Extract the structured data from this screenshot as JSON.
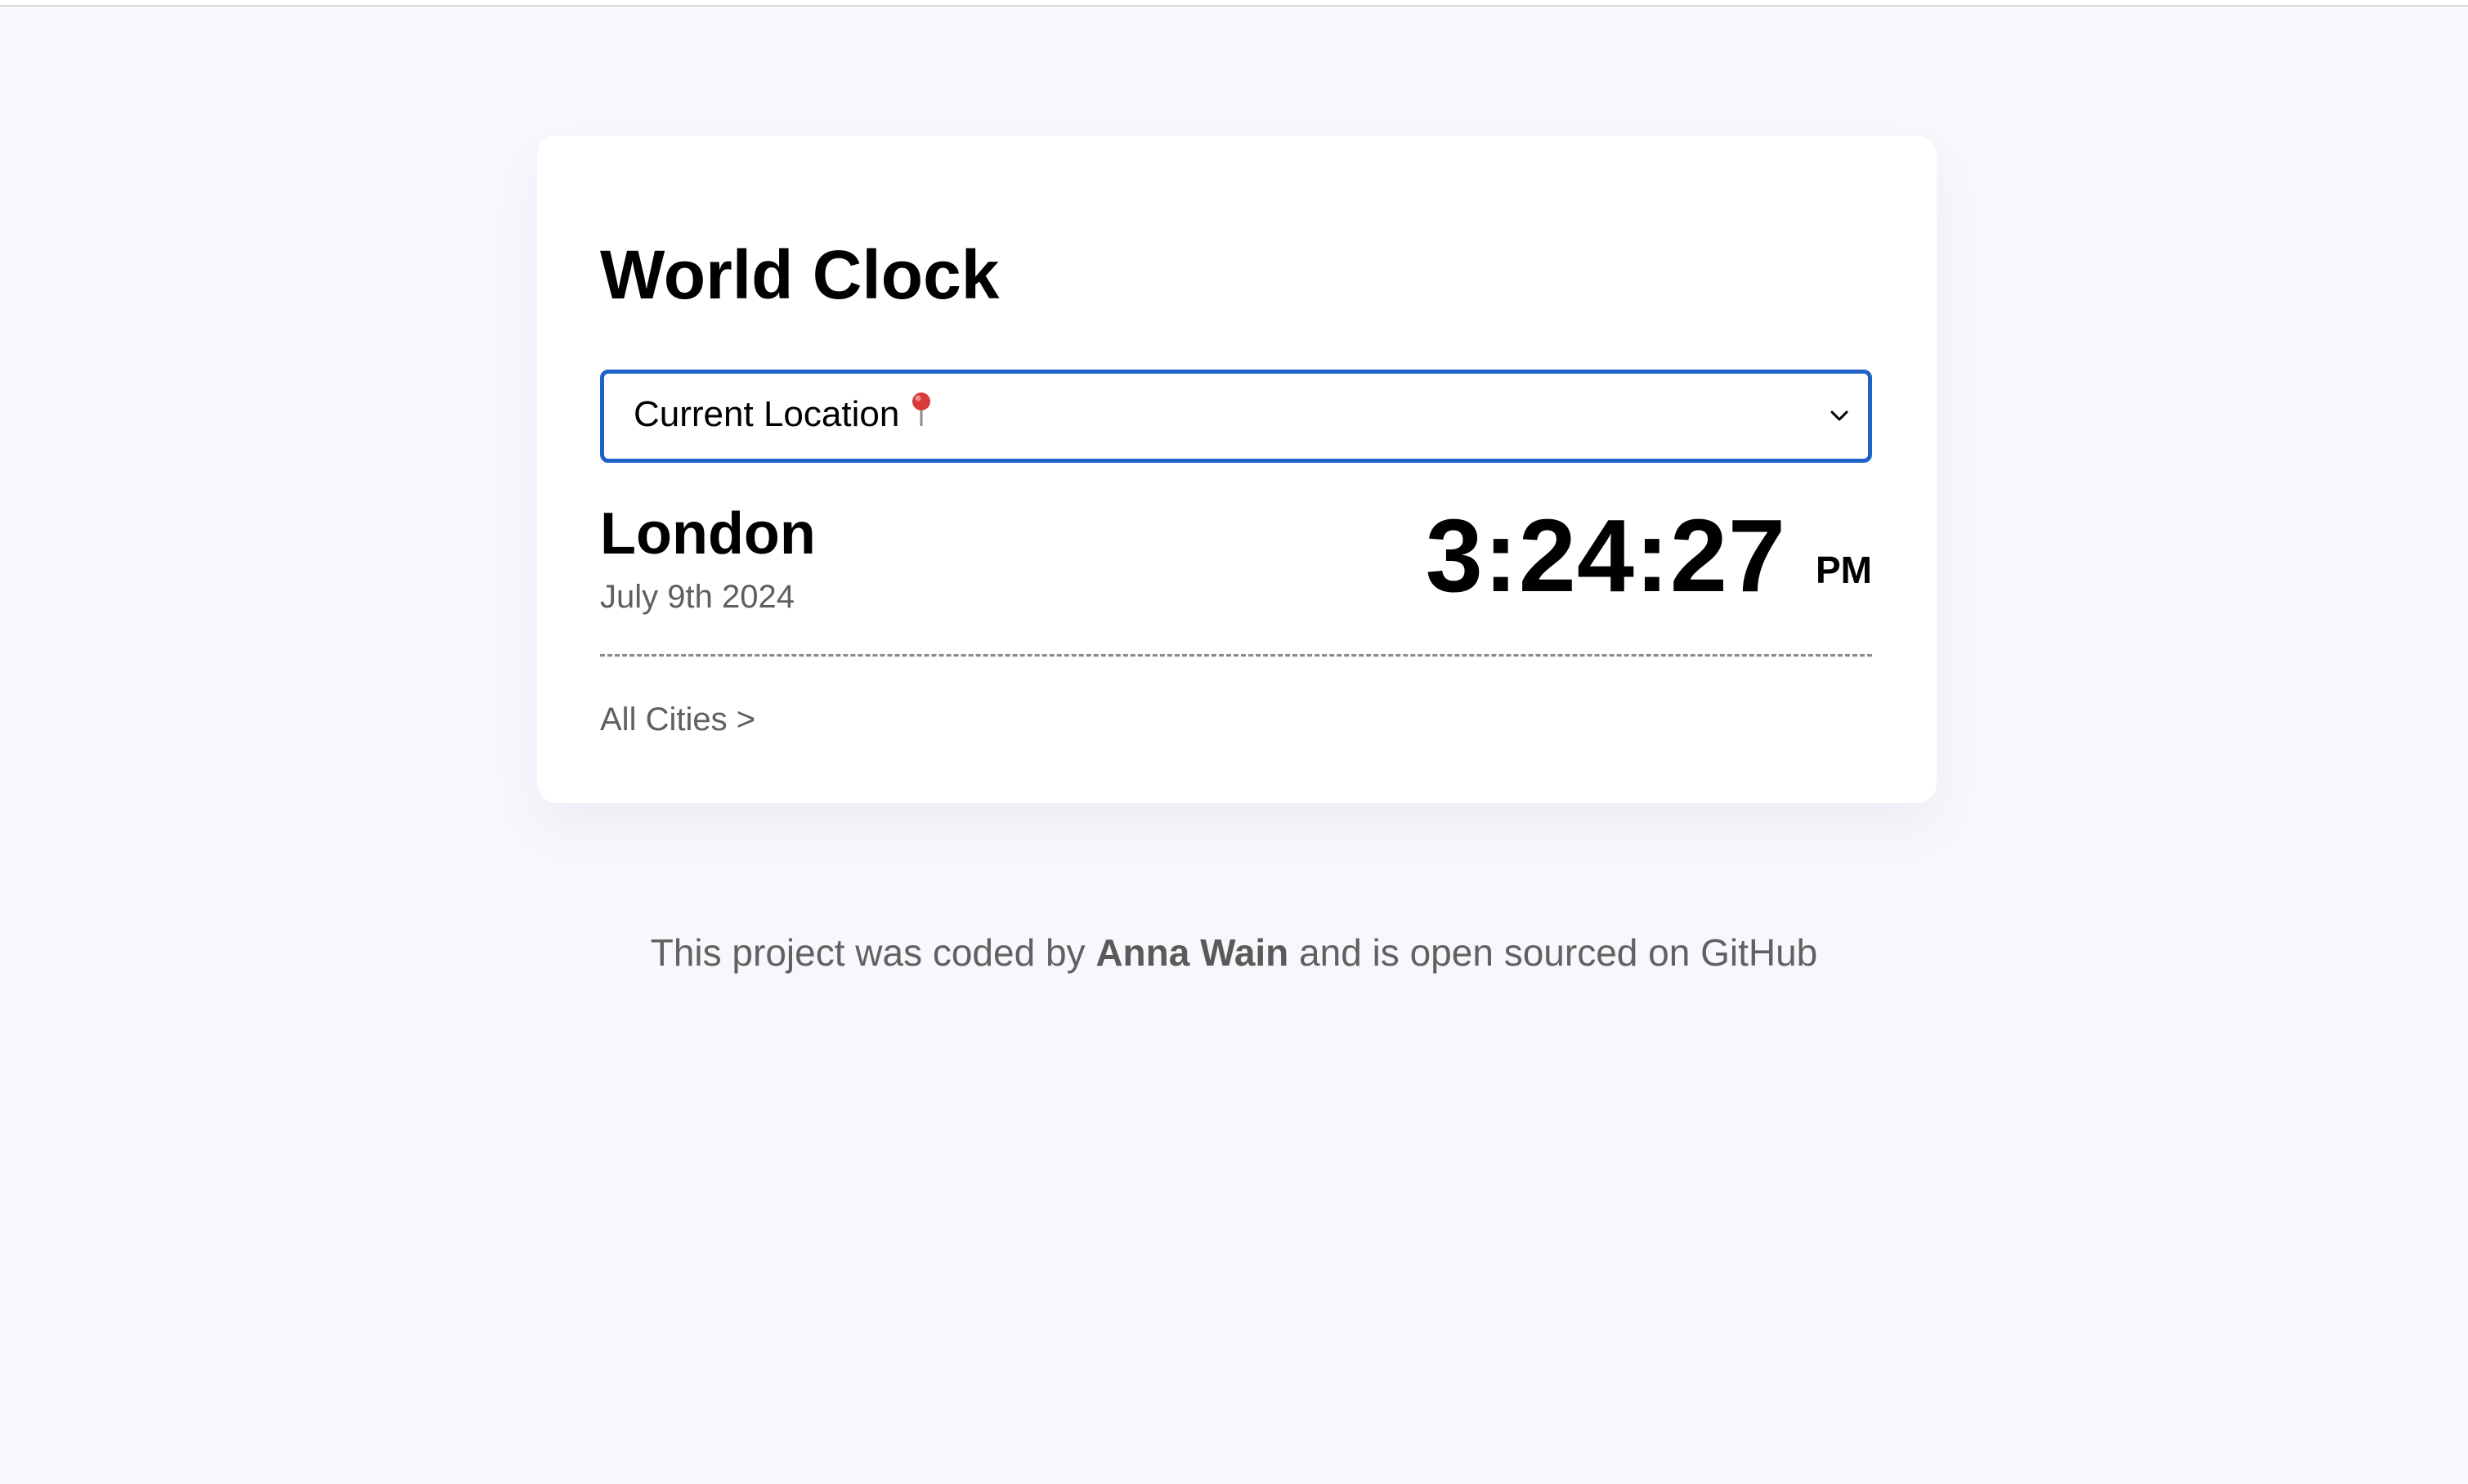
{
  "app": {
    "title": "World Clock"
  },
  "location_select": {
    "selected_label": "Current Location",
    "selected_icon": "round-pushpin-icon"
  },
  "city": {
    "name": "London",
    "date": "July 9th 2024",
    "time": "3:24:27",
    "period": "PM"
  },
  "links": {
    "all_cities": "All Cities >"
  },
  "footer": {
    "prefix": "This project was coded by ",
    "author": "Anna Wain",
    "middle": " and is ",
    "open_sourced": "open sourced on GitHub"
  },
  "colors": {
    "background": "#f8f7fc",
    "card": "#ffffff",
    "select_border": "#1f63c6",
    "muted_text": "#5f5f5f",
    "pin": "#d93a3a"
  }
}
